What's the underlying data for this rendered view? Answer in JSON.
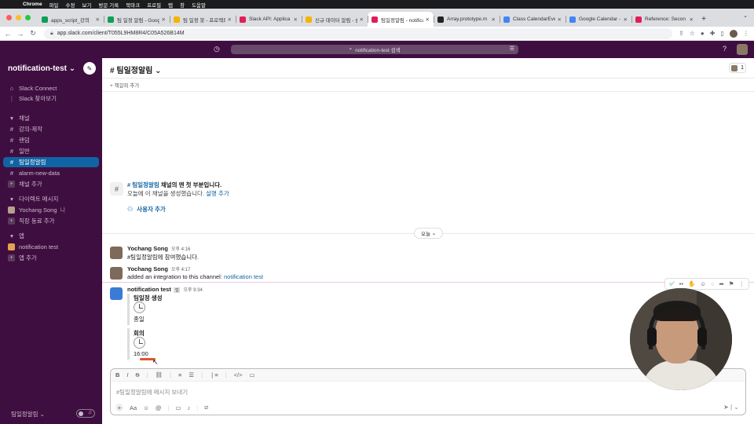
{
  "menubar": {
    "app": "Chrome",
    "items": [
      "파일",
      "수정",
      "보기",
      "방문 기록",
      "북마크",
      "프로필",
      "탭",
      "창",
      "도움말"
    ]
  },
  "browser": {
    "tabs": [
      {
        "title": "apps_script_강의",
        "color": "#0f9d58"
      },
      {
        "title": "팀 일정 알림 - Goog",
        "color": "#0f9d58"
      },
      {
        "title": "팀 일정 봇 - 프로젝트",
        "color": "#f4b400"
      },
      {
        "title": "Slack API: Applica",
        "color": "#e01e5a"
      },
      {
        "title": "신규 데이터 알림 - 슬",
        "color": "#f4b400"
      },
      {
        "title": "팀일정알림 - notifica",
        "color": "#e01e5a",
        "active": true
      },
      {
        "title": "Array.prototype.m",
        "color": "#222222"
      },
      {
        "title": "Class CalendarEve",
        "color": "#4285f4"
      },
      {
        "title": "Google Calendar -",
        "color": "#4285f4"
      },
      {
        "title": "Reference: Secon",
        "color": "#e01e5a"
      }
    ],
    "url": "app.slack.com/client/T055L9HM8R4/C05A526B14M"
  },
  "slack_top": {
    "search_placeholder": "notification-test 검색"
  },
  "sidebar": {
    "workspace": "notification-test",
    "top_items": [
      {
        "label": "Slack Connect",
        "icon": "slack-connect-icon"
      },
      {
        "label": "Slack 찾아보기",
        "icon": "more-icon"
      }
    ],
    "channels_header": "채널",
    "channels": [
      {
        "label": "강의-제작",
        "active": false
      },
      {
        "label": "랜덤",
        "active": false
      },
      {
        "label": "일반",
        "active": false
      },
      {
        "label": "팀일정알림",
        "active": true
      },
      {
        "label": "alarm-new-data",
        "active": false
      }
    ],
    "add_channel": "채널 추가",
    "dm_header": "다이렉트 메시지",
    "dm_user": "Yochang Song",
    "dm_me": "나",
    "add_coworker": "직장 동료 추가",
    "apps_header": "앱",
    "app_item": "notification test",
    "add_app": "앱 추가",
    "bottom_label": "팀일정알림"
  },
  "channel": {
    "name": "팀일정알림",
    "member_count": "1",
    "bookmark": "책갈피 추가",
    "intro_channel": "# 팀일정알림",
    "intro_suffix": " 채널의 맨 첫 부분입니다.",
    "intro_line2": "오늘에 이 채널을 생성했습니다.",
    "intro_link": "설명 추가",
    "add_user": "사용자 추가",
    "day_divider": "오늘"
  },
  "messages": [
    {
      "author": "Yochang Song",
      "time": "오후 4:16",
      "text": "#팀일정알림에 참여했습니다."
    },
    {
      "author": "Yochang Song",
      "time": "오후 4:17",
      "text": "added an integration to this channel: ",
      "link": "notification test"
    },
    {
      "author": "notification test",
      "time": "오후 9:34",
      "app_badge": "앱"
    }
  ],
  "attachments": [
    {
      "title": "팀일정 생성",
      "value": "종일"
    },
    {
      "title": "회의",
      "value": "16:00"
    }
  ],
  "composer": {
    "placeholder": "#팀일정알림에 메시지 보내기"
  }
}
